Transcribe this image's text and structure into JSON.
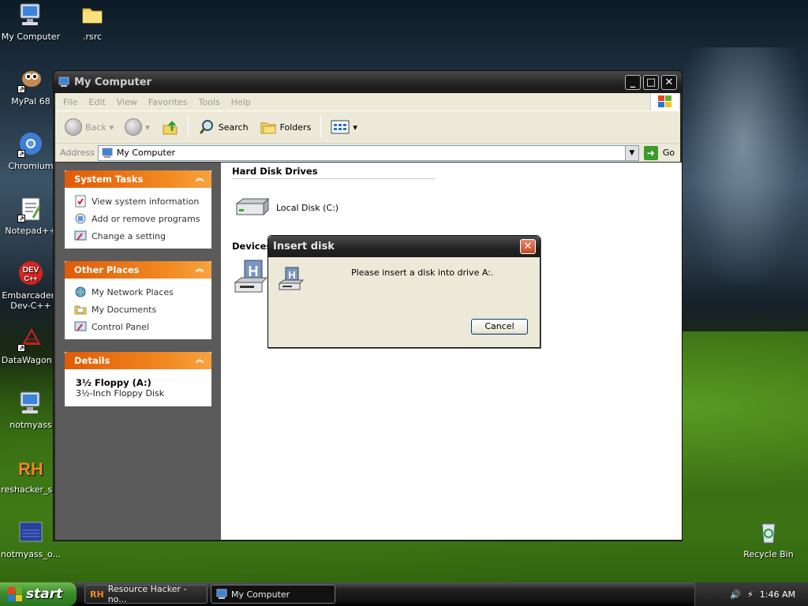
{
  "desktop": {
    "icons": [
      {
        "label": "My Computer"
      },
      {
        "label": ".rsrc"
      },
      {
        "label": "MyPal 68"
      },
      {
        "label": "Chromium"
      },
      {
        "label": "Notepad++"
      },
      {
        "label": "Embarcadero Dev-C++"
      },
      {
        "label": "DataWagon..."
      },
      {
        "label": "notmyass"
      },
      {
        "label": "reshacker_s..."
      },
      {
        "label": "notmyass_o..."
      },
      {
        "label": "Recycle Bin"
      }
    ]
  },
  "window": {
    "title": "My Computer",
    "menu": [
      "File",
      "Edit",
      "View",
      "Favorites",
      "Tools",
      "Help"
    ],
    "toolbar": {
      "back": "Back",
      "search": "Search",
      "folders": "Folders"
    },
    "address": {
      "label": "Address",
      "value": "My Computer",
      "go": "Go"
    },
    "left_pane": {
      "system_tasks": {
        "title": "System Tasks",
        "items": [
          "View system information",
          "Add or remove programs",
          "Change a setting"
        ]
      },
      "other_places": {
        "title": "Other Places",
        "items": [
          "My Network Places",
          "My Documents",
          "Control Panel"
        ]
      },
      "details": {
        "title": "Details",
        "name": "3½ Floppy (A:)",
        "type": "3½-Inch Floppy Disk"
      }
    },
    "content": {
      "hard_disk_group": "Hard Disk Drives",
      "local_disk": "Local Disk (C:)",
      "devices_group": "Devices"
    }
  },
  "dialog": {
    "title": "Insert disk",
    "message": "Please insert a disk into drive A:.",
    "cancel": "Cancel"
  },
  "taskbar": {
    "start": "start",
    "tasks": [
      "Resource Hacker - no...",
      "My Computer"
    ],
    "clock": "1:46 AM"
  }
}
